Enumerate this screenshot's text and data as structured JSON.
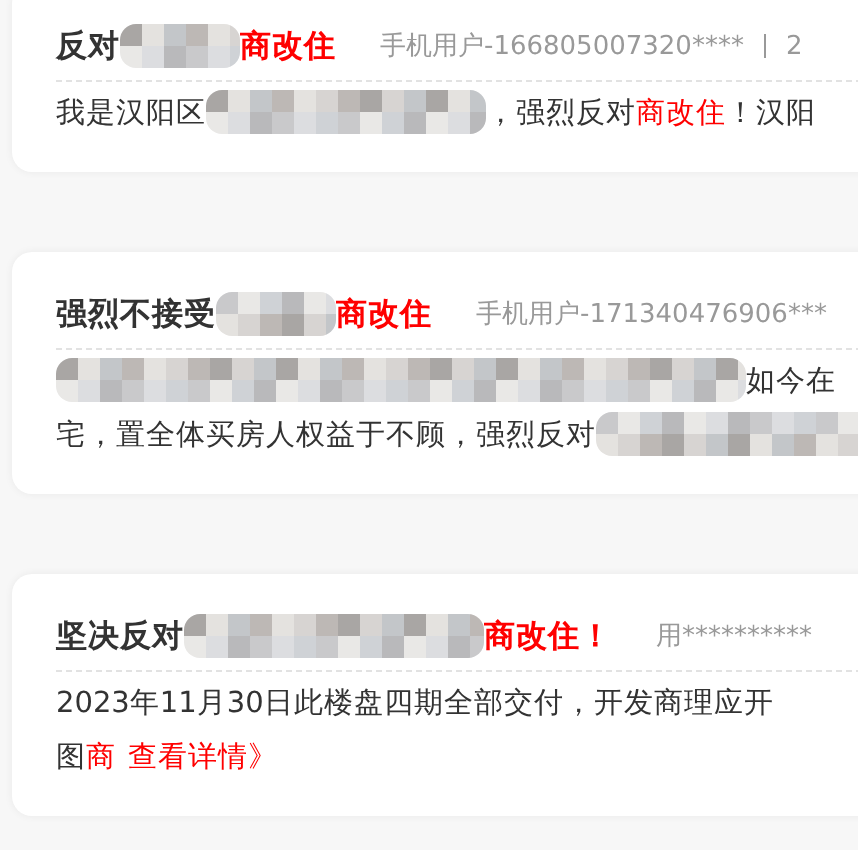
{
  "posts": [
    {
      "title": [
        {
          "kind": "text",
          "text": "反对"
        },
        {
          "kind": "redacted"
        },
        {
          "kind": "highlight",
          "text": "商改住"
        }
      ],
      "author": [
        "手机用户-166805007320****",
        "2"
      ],
      "lines": [
        [
          {
            "kind": "text",
            "text": "我是汉阳区"
          },
          {
            "kind": "redacted"
          },
          {
            "kind": "text",
            "text": "，强烈反对"
          },
          {
            "kind": "highlight",
            "text": "商改住"
          },
          {
            "kind": "text",
            "text": "！汉阳"
          }
        ]
      ]
    },
    {
      "title": [
        {
          "kind": "text",
          "text": "强烈不接受"
        },
        {
          "kind": "redacted"
        },
        {
          "kind": "highlight",
          "text": "商改住"
        }
      ],
      "author": [
        "手机用户-171340476906***"
      ],
      "lines": [
        [
          {
            "kind": "redacted"
          },
          {
            "kind": "text",
            "text": "如今在"
          }
        ],
        [
          {
            "kind": "text",
            "text": "宅，置全体买房人权益于不顾，强烈反对"
          },
          {
            "kind": "redacted"
          }
        ]
      ]
    },
    {
      "title": [
        {
          "kind": "text",
          "text": "坚决反对"
        },
        {
          "kind": "redacted"
        },
        {
          "kind": "highlight",
          "text": "商改住！"
        }
      ],
      "author": [
        "用**********"
      ],
      "lines": [
        [
          {
            "kind": "text",
            "text": "2023年11月30日此楼盘四期全部交付，开发商理应开"
          }
        ],
        [
          {
            "kind": "text",
            "text": "图"
          },
          {
            "kind": "highlight",
            "text": "商"
          },
          {
            "kind": "link",
            "text": "查看详情》"
          }
        ]
      ]
    }
  ]
}
